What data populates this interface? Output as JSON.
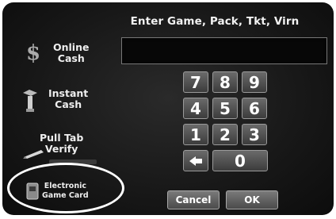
{
  "prompt": "Enter Game, Pack, Tkt, Virn",
  "entry_value": "",
  "menu": {
    "online": {
      "line1": "Online",
      "line2": "Cash",
      "icon": "dollar-coin-icon"
    },
    "instant": {
      "line1": "Instant",
      "line2": "Cash",
      "icon": "scratch-ticket-icon"
    },
    "pulltab": {
      "line1": "Pull Tab",
      "line2": "Verify",
      "icon": "pen-icon"
    },
    "egc": {
      "line1": "Electronic",
      "line2": "Game Card",
      "icon": "card-icon"
    }
  },
  "keypad": {
    "k7": "7",
    "k8": "8",
    "k9": "9",
    "k4": "4",
    "k5": "5",
    "k6": "6",
    "k1": "1",
    "k2": "2",
    "k3": "3",
    "k0": "0",
    "back_icon": "backspace-arrow-icon"
  },
  "actions": {
    "cancel": "Cancel",
    "ok": "OK"
  }
}
